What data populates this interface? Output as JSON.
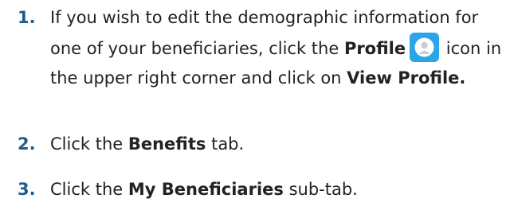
{
  "steps": [
    {
      "number": "1.",
      "text_before": "If you wish to edit the demographic information for one of your beneficiaries, click the ",
      "profile_label": "Profile",
      "text_middle": " icon in the upper right corner and click on ",
      "view_profile_label": "View Profile.",
      "icon": "profile-avatar-icon"
    },
    {
      "number": "2.",
      "text_before": "Click the ",
      "bold": "Benefits",
      "text_after": " tab."
    },
    {
      "number": "3.",
      "text_before": "Click the ",
      "bold": "My Beneficiaries",
      "text_after": " sub-tab."
    }
  ],
  "colors": {
    "step_number": "#1f5d8c",
    "text": "#222222",
    "icon_bg": "#2aa6e8"
  }
}
